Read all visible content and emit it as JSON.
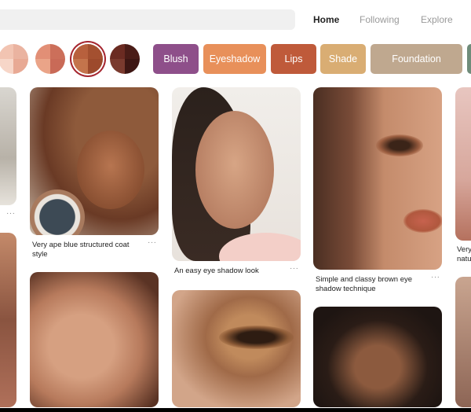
{
  "header": {
    "tabs": [
      {
        "label": "Home",
        "active": true
      },
      {
        "label": "Following",
        "active": false
      },
      {
        "label": "Explore",
        "active": false
      }
    ]
  },
  "swatches": [
    {
      "name": "peach",
      "colors": [
        "#f2c4b2",
        "#eab3a0",
        "#f7d6c8",
        "#e8a994"
      ],
      "selected": false
    },
    {
      "name": "coral-blend",
      "colors": [
        "#e28f76",
        "#cc6f5a",
        "#eaa488",
        "#c96a57"
      ],
      "selected": false
    },
    {
      "name": "copper",
      "colors": [
        "#b8603d",
        "#a45030",
        "#c4744c",
        "#9d4a2c"
      ],
      "selected": true
    },
    {
      "name": "brown",
      "colors": [
        "#6b2b22",
        "#4a1c17",
        "#7a3a2e",
        "#3d1613"
      ],
      "selected": false
    }
  ],
  "categories": [
    {
      "label": "Blush",
      "color": "#8e4f8a"
    },
    {
      "label": "Eyeshadow",
      "color": "#e8905a"
    },
    {
      "label": "Lips",
      "color": "#bf5a3a"
    },
    {
      "label": "Shade",
      "color": "#d9ad73"
    },
    {
      "label": "Foundation",
      "color": "#bfa88f"
    },
    {
      "label": "",
      "color": "#6f8c7a"
    }
  ],
  "pins": [
    {
      "caption": "Very ape blue structured coat style"
    },
    {
      "caption": "An easy eye shadow look"
    },
    {
      "caption": "Simple and classy brown eye shadow technique"
    },
    {
      "caption": "Very natu"
    }
  ],
  "more_label": "···",
  "colors": {
    "accent": "#a5262f",
    "background": "#ffffff"
  }
}
